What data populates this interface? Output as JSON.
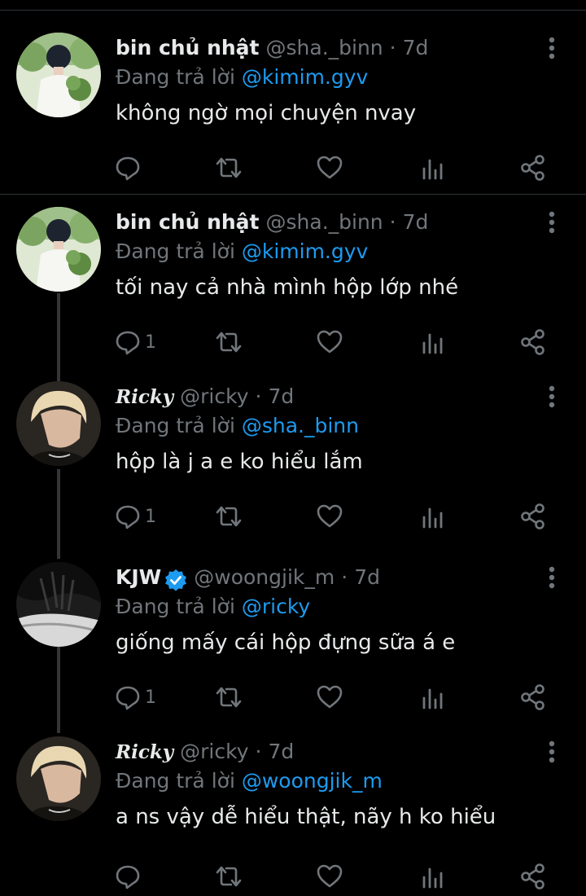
{
  "reply_prefix": "Đang trả lời",
  "colors": {
    "background": "#000000",
    "text": "#e7e9ea",
    "muted": "#71767b",
    "link": "#1d9bf0",
    "verified": "#1d9bf0",
    "divider": "#2f3336",
    "thread_line": "#333639"
  },
  "icons": [
    "more-icon",
    "reply-icon",
    "retweet-icon",
    "like-icon",
    "views-icon",
    "share-icon",
    "verified-badge-icon"
  ],
  "tweets": [
    {
      "name": "bin chủ nhật",
      "handle": "@sha._binn",
      "time": "7d",
      "reply_to": "@kimim.gyv",
      "text": "không ngờ mọi chuyện nvay",
      "reply_count": "",
      "verified": false
    },
    {
      "name": "bin chủ nhật",
      "handle": "@sha._binn",
      "time": "7d",
      "reply_to": "@kimim.gyv",
      "text": "tối nay cả nhà mình hộp lớp nhé",
      "reply_count": "1",
      "verified": false
    },
    {
      "name": "Ricky",
      "handle": "@ricky",
      "time": "7d",
      "reply_to": "@sha._binn",
      "text": "hộp là j a e ko hiểu lắm",
      "reply_count": "1",
      "verified": false
    },
    {
      "name": "KJW",
      "handle": "@woongjik_m",
      "time": "7d",
      "reply_to": "@ricky",
      "text": "giống mấy cái hộp đựng sữa á e",
      "reply_count": "1",
      "verified": true
    },
    {
      "name": "Ricky",
      "handle": "@ricky",
      "time": "7d",
      "reply_to": "@woongjik_m",
      "text": "a ns vậy dễ hiểu thật, nãy h ko hiểu",
      "reply_count": "",
      "verified": false
    }
  ]
}
